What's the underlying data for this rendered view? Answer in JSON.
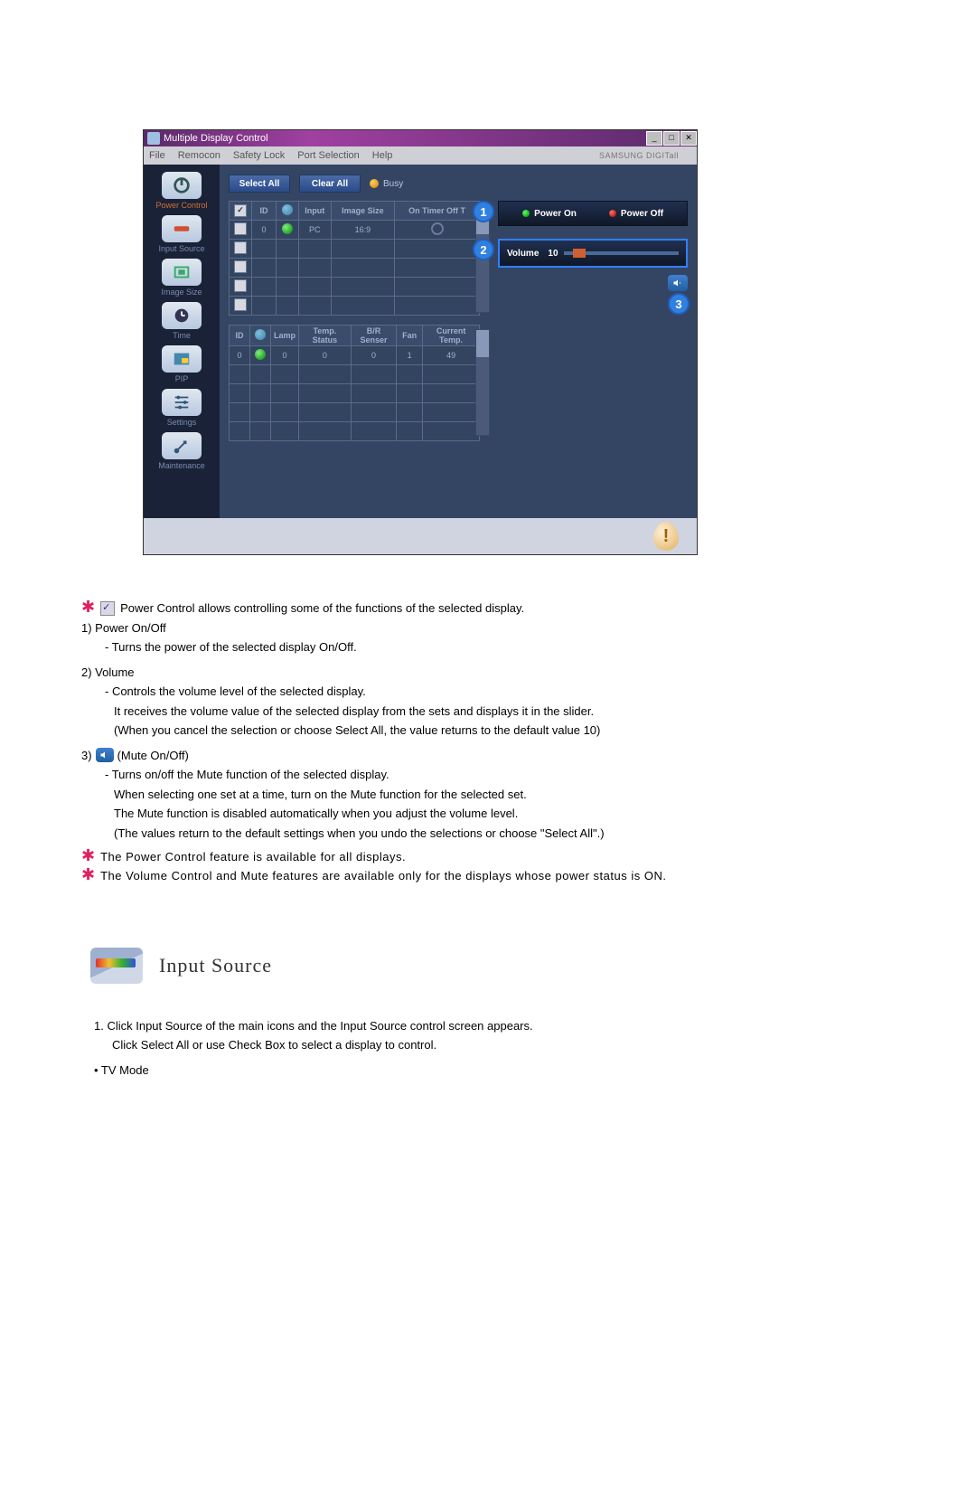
{
  "window": {
    "title": "Multiple Display Control",
    "menu": [
      "File",
      "Remocon",
      "Safety Lock",
      "Port Selection",
      "Help"
    ],
    "brand": "SAMSUNG DIGITall"
  },
  "sidebar": {
    "items": [
      {
        "label": "Power Control",
        "icon": "power-icon",
        "active": true
      },
      {
        "label": "Input Source",
        "icon": "input-icon"
      },
      {
        "label": "Image Size",
        "icon": "image-size-icon"
      },
      {
        "label": "Time",
        "icon": "time-icon"
      },
      {
        "label": "PIP",
        "icon": "pip-icon"
      },
      {
        "label": "Settings",
        "icon": "settings-icon"
      },
      {
        "label": "Maintenance",
        "icon": "maintenance-icon"
      }
    ]
  },
  "toolbar": {
    "select_all": "Select All",
    "clear_all": "Clear All",
    "busy": "Busy"
  },
  "table1": {
    "headers": [
      "",
      "ID",
      "",
      "Input",
      "Image Size",
      "On Timer Off T"
    ],
    "row": {
      "id": "0",
      "input": "PC",
      "size": "16:9"
    }
  },
  "table2": {
    "headers": [
      "ID",
      "",
      "Lamp",
      "Temp. Status",
      "B/R Senser",
      "Fan",
      "Current Temp."
    ],
    "row": {
      "id": "0",
      "lamp": "0",
      "temp_status": "0",
      "br": "0",
      "fan": "1",
      "cur": "49"
    }
  },
  "panel": {
    "power_on": "Power On",
    "power_off": "Power Off",
    "volume_label": "Volume",
    "volume_value": "10"
  },
  "badges": {
    "b1": "1",
    "b2": "2",
    "b3": "3"
  },
  "doc": {
    "intro": "Power Control allows controlling some of the functions of the selected display.",
    "i1_t": "1)  Power On/Off",
    "i1_d": "- Turns the power of the selected display On/Off.",
    "i2_t": "2)  Volume",
    "i2_d1": "- Controls the volume level of the selected display.",
    "i2_d2": "It receives the volume value of the selected display from the sets and displays it in the slider.",
    "i2_d3": "(When you cancel the selection or choose Select All, the value returns to the default value 10)",
    "i3_t": "3)",
    "i3_l": "(Mute On/Off)",
    "i3_d1": "- Turns on/off the Mute function of the selected display.",
    "i3_d2": "When selecting one set at a time, turn on the Mute function for the selected set.",
    "i3_d3": "The Mute function is disabled automatically when you adjust the volume level.",
    "i3_d4": "(The values return to the default settings when you undo the selections or choose \"Select All\".)",
    "n1": "The Power Control feature is available for all displays.",
    "n2": "The Volume Control and Mute features are available only for the displays whose power status is ON."
  },
  "section": {
    "title": "Input Source",
    "p1": "1.  Click Input Source of the main icons and the Input Source control screen appears.",
    "p2": "Click Select All or use Check Box to select a display to control.",
    "p3": "•  TV Mode"
  }
}
